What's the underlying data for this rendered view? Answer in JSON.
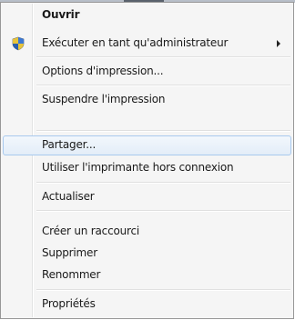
{
  "menu": {
    "items": [
      {
        "label": "Ouvrir"
      },
      {
        "label": "Exécuter en tant qu'administrateur",
        "icon": "uac-shield-icon",
        "submenu": true
      },
      {
        "label": "Options d'impression..."
      },
      {
        "label": "Suspendre l'impression"
      },
      {
        "label": "Partager..."
      },
      {
        "label": "Utiliser l'imprimante hors connexion"
      },
      {
        "label": "Actualiser"
      },
      {
        "label": "Créer un raccourci"
      },
      {
        "label": "Supprimer"
      },
      {
        "label": "Renommer"
      },
      {
        "label": "Propriétés"
      }
    ],
    "highlighted_item": "Partager...",
    "colors": {
      "hover_border": "#a8c9ee",
      "hover_fill": "#e3edf8",
      "background": "#f5f5f5"
    }
  }
}
